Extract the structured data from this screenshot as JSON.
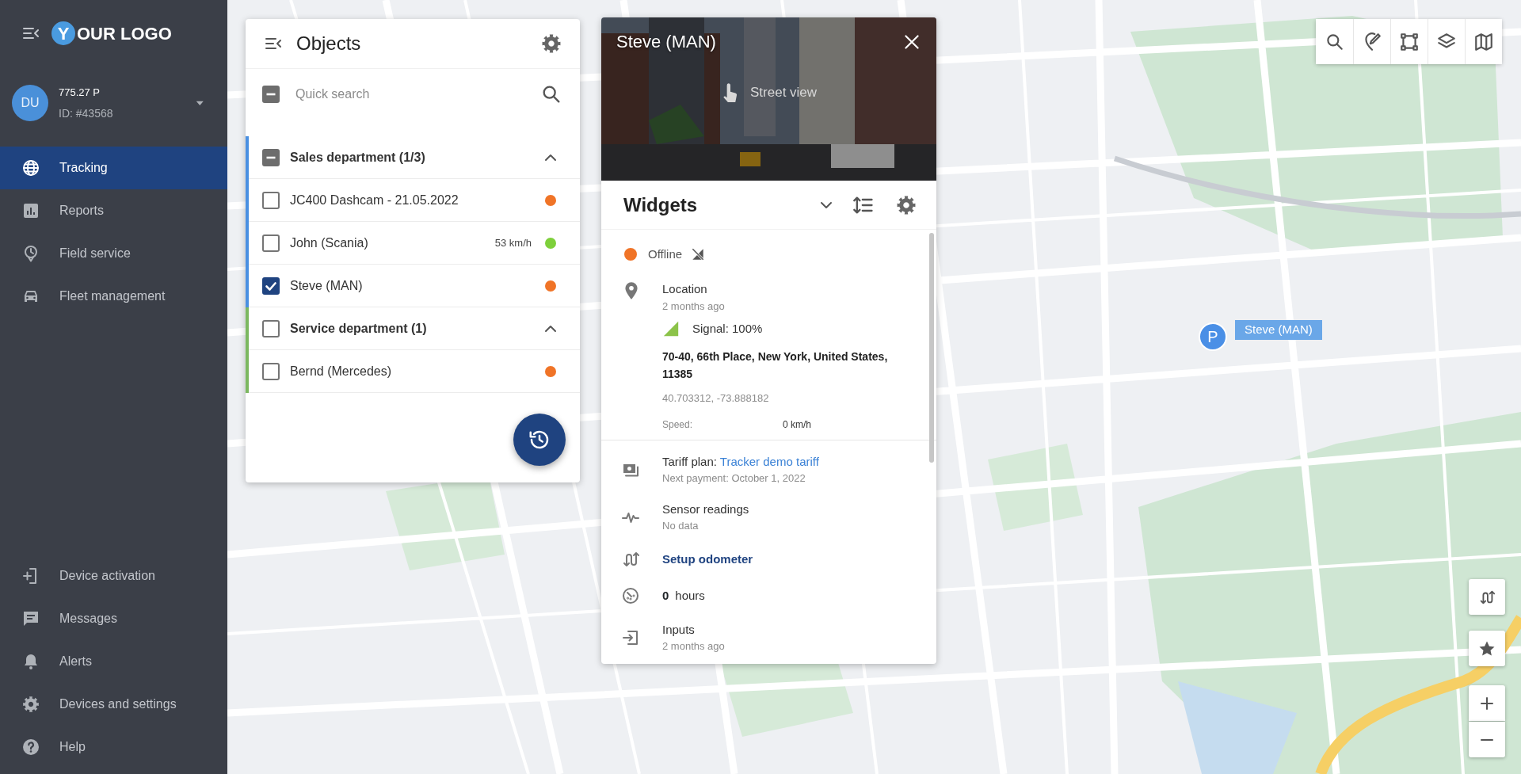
{
  "sidebar": {
    "logo": {
      "badge": "Y",
      "text": "OUR LOGO"
    },
    "account": {
      "avatar": "DU",
      "balance": "775.27 P",
      "id": "ID: #43568"
    },
    "nav_items": [
      {
        "label": "Tracking",
        "selected": true
      },
      {
        "label": "Reports",
        "selected": false
      },
      {
        "label": "Field service",
        "selected": false
      },
      {
        "label": "Fleet management",
        "selected": false
      }
    ],
    "bottom_items": [
      {
        "label": "Device activation",
        "selected": false
      },
      {
        "label": "Messages",
        "selected": false
      },
      {
        "label": "Alerts",
        "selected": false
      },
      {
        "label": "Devices and settings",
        "selected": false
      },
      {
        "label": "Help",
        "selected": false
      }
    ]
  },
  "objects_panel": {
    "title": "Objects",
    "search": {
      "placeholder": "Quick search"
    },
    "select_all": {
      "indeterminate": true
    },
    "groups": [
      {
        "name": "Sales department (1/3)",
        "indeterminate": true,
        "expanded": true,
        "color": "#4a90e2",
        "items": [
          {
            "name": "JC400 Dashcam - 21.05.2022",
            "checked": false,
            "color": "#f07427"
          },
          {
            "name": "John (Scania)",
            "speed": "53 km/h",
            "checked": false,
            "color": "#7ed03b"
          },
          {
            "name": "Steve (MAN)",
            "checked": true,
            "color": "#f07427"
          }
        ]
      },
      {
        "name": "Service department (1)",
        "indeterminate": false,
        "expanded": true,
        "color": "#7cb860",
        "items": [
          {
            "name": "Bernd (Mercedes)",
            "checked": false,
            "color": "#f07427"
          }
        ]
      }
    ]
  },
  "details_panel": {
    "title": "Steve (MAN)",
    "street_view": "Street view",
    "widgets_title": "Widgets",
    "status": {
      "label": "Offline",
      "color": "#f07427"
    },
    "location": {
      "title": "Location",
      "time": "2 months ago",
      "signal": "Signal: 100%",
      "address": "70-40, 66th Place, New York, United States, 11385",
      "coords": "40.703312, -73.888182",
      "speed_label": "Speed:",
      "speed": "0 km/h"
    },
    "rows": [
      {
        "kind": "tariff",
        "label": "Tariff plan:",
        "link": "Tracker demo tariff",
        "sub": "Next payment: October 1, 2022"
      },
      {
        "kind": "sensor",
        "title": "Sensor readings",
        "sub": "No data"
      },
      {
        "kind": "odometer",
        "link": "Setup odometer"
      },
      {
        "kind": "hours",
        "value": "0",
        "unit": "hours"
      },
      {
        "kind": "inputs",
        "title": "Inputs",
        "sub": "2 months ago"
      }
    ]
  },
  "map": {
    "marker": {
      "letter": "P",
      "label": "Steve (MAN)"
    }
  }
}
